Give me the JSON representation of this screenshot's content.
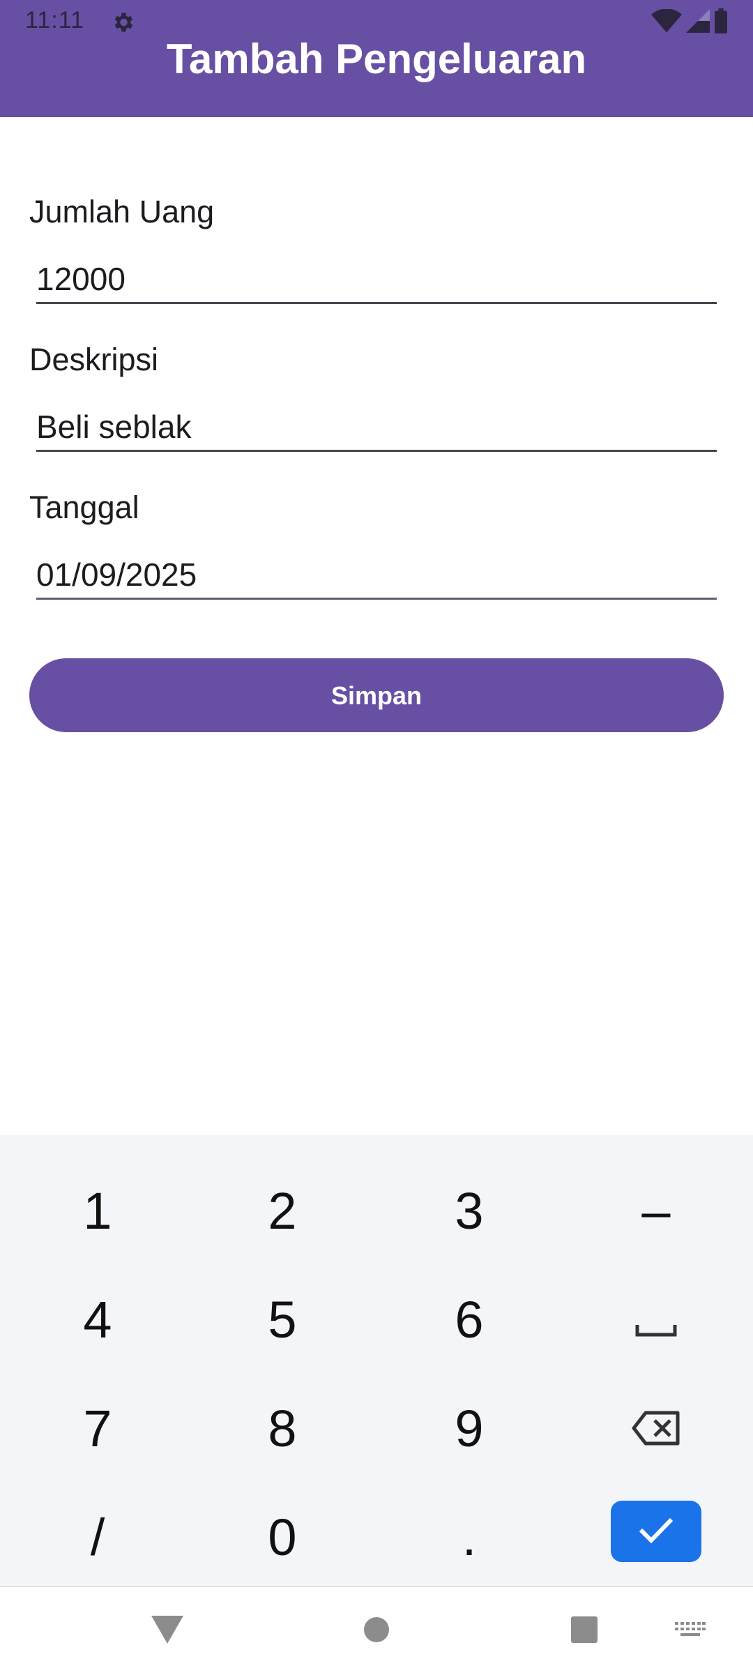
{
  "status_bar": {
    "time": "11:11",
    "icons": [
      "gear-icon",
      "wifi-icon",
      "signal-icon",
      "battery-icon"
    ]
  },
  "app_bar": {
    "title": "Tambah Pengeluaran",
    "color": "#6750A4"
  },
  "form": {
    "amount": {
      "label": "Jumlah Uang",
      "value": "12000"
    },
    "description": {
      "label": "Deskripsi",
      "value": "Beli seblak"
    },
    "date": {
      "label": "Tanggal",
      "value": "01/09/2025"
    },
    "save_label": "Simpan"
  },
  "keyboard": {
    "rows": [
      [
        "1",
        "2",
        "3",
        "–"
      ],
      [
        "4",
        "5",
        "6",
        "space"
      ],
      [
        "7",
        "8",
        "9",
        "backspace"
      ],
      [
        "/",
        "0",
        ".",
        "done"
      ]
    ],
    "key_labels": {
      "k1": "1",
      "k2": "2",
      "k3": "3",
      "dash": "–",
      "k4": "4",
      "k5": "5",
      "k6": "6",
      "k7": "7",
      "k8": "8",
      "k9": "9",
      "slash": "/",
      "k0": "0",
      "dot": "."
    },
    "done_color": "#1a73e8"
  },
  "nav_bar": {
    "items": [
      "back-icon",
      "home-icon",
      "recents-icon",
      "keyboard-switch-icon"
    ]
  }
}
